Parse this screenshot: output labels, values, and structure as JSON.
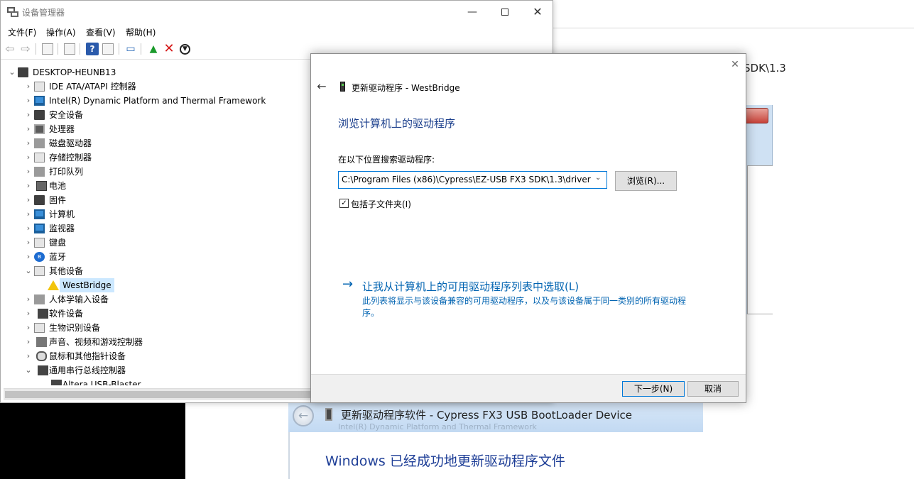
{
  "background": {
    "partial_path_text": "SDK\\1.3",
    "win7_dialog": {
      "title": "更新驱动程序软件 - Cypress FX3 USB BootLoader Device",
      "ghost_text": "Intel(R) Dynamic Platform and Thermal Framework",
      "heading": "Windows 已经成功地更新驱动程序文件",
      "back_icon": "back-arrow-icon"
    }
  },
  "device_manager": {
    "title": "设备管理器",
    "caption": {
      "minimize": "—",
      "close": "✕"
    },
    "menu": [
      "文件(F)",
      "操作(A)",
      "查看(V)",
      "帮助(H)"
    ],
    "toolbar_icons": [
      "back-icon",
      "forward-icon",
      "properties-icon",
      "list-view-icon",
      "help-icon",
      "details-icon",
      "scan-hardware-icon",
      "update-driver-icon",
      "uninstall-icon",
      "disable-icon"
    ],
    "tree": {
      "root": "DESKTOP-HEUNB13",
      "items": [
        {
          "label": "IDE ATA/ATAPI 控制器",
          "expanded": false,
          "icon": "ide-controller-icon"
        },
        {
          "label": "Intel(R) Dynamic Platform and Thermal Framework",
          "expanded": false,
          "icon": "thermal-framework-icon"
        },
        {
          "label": "安全设备",
          "expanded": false,
          "icon": "security-device-icon"
        },
        {
          "label": "处理器",
          "expanded": false,
          "icon": "processor-icon"
        },
        {
          "label": "磁盘驱动器",
          "expanded": false,
          "icon": "disk-drive-icon"
        },
        {
          "label": "存储控制器",
          "expanded": false,
          "icon": "storage-controller-icon"
        },
        {
          "label": "打印队列",
          "expanded": false,
          "icon": "printer-icon"
        },
        {
          "label": "电池",
          "expanded": false,
          "icon": "battery-icon"
        },
        {
          "label": "固件",
          "expanded": false,
          "icon": "firmware-icon"
        },
        {
          "label": "计算机",
          "expanded": false,
          "icon": "computer-icon"
        },
        {
          "label": "监视器",
          "expanded": false,
          "icon": "monitor-icon"
        },
        {
          "label": "键盘",
          "expanded": false,
          "icon": "keyboard-icon"
        },
        {
          "label": "蓝牙",
          "expanded": false,
          "icon": "bluetooth-icon"
        },
        {
          "label": "其他设备",
          "expanded": true,
          "icon": "other-devices-icon"
        },
        {
          "label": "WestBridge",
          "child": true,
          "selected": true,
          "icon": "warning-device-icon"
        },
        {
          "label": "人体学输入设备",
          "expanded": false,
          "icon": "hid-icon"
        },
        {
          "label": "软件设备",
          "expanded": false,
          "icon": "software-device-icon"
        },
        {
          "label": "生物识别设备",
          "expanded": false,
          "icon": "biometric-icon"
        },
        {
          "label": "声音、视频和游戏控制器",
          "expanded": false,
          "icon": "sound-icon"
        },
        {
          "label": "鼠标和其他指针设备",
          "expanded": false,
          "icon": "mouse-icon"
        },
        {
          "label": "通用串行总线控制器",
          "expanded": true,
          "icon": "usb-controller-icon"
        },
        {
          "label": "Altera USB-Blaster",
          "child": true,
          "icon": "usb-device-icon"
        }
      ]
    }
  },
  "update_dialog": {
    "title": "更新驱动程序 - WestBridge",
    "heading": "浏览计算机上的驱动程序",
    "search_label": "在以下位置搜索驱动程序:",
    "path_value": "C:\\Program Files (x86)\\Cypress\\EZ-USB FX3 SDK\\1.3\\driver",
    "browse_button": "浏览(R)...",
    "include_subfolders": "包括子文件夹(I)",
    "include_subfolders_checked": true,
    "pick_link": "让我从计算机上的可用驱动程序列表中选取(L)",
    "pick_desc": "此列表将显示与该设备兼容的可用驱动程序，以及与该设备属于同一类别的所有驱动程序。",
    "next_button": "下一步(N)",
    "cancel_button": "取消",
    "close_glyph": "✕",
    "back_glyph": "←",
    "link_arrow_glyph": "→"
  }
}
